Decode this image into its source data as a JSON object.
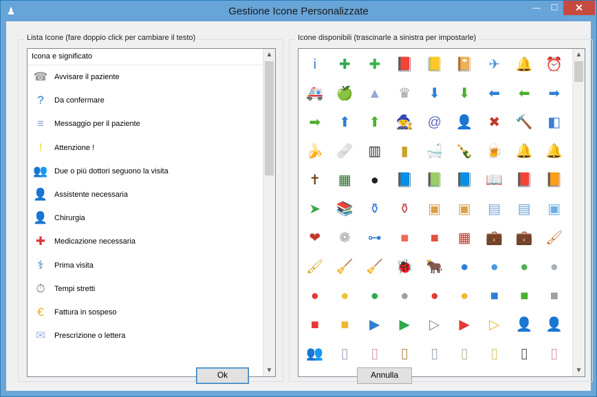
{
  "window": {
    "title": "Gestione Icone Personalizzate",
    "minimize": "—",
    "maximize": "☐",
    "close": "✕",
    "app_icon": "♟"
  },
  "left_panel": {
    "title": "Lista Icone (fare doppio click per cambiare il testo)",
    "header": "Icona e significato",
    "items": [
      {
        "label": "Avvisare il paziente",
        "icon": "phone-icon",
        "glyph": "☎",
        "color": "#9a9a9a"
      },
      {
        "label": "Da confermare",
        "icon": "question-icon",
        "glyph": "?",
        "color": "#2d79c9"
      },
      {
        "label": "Messaggio per il paziente",
        "icon": "message-icon",
        "glyph": "≡",
        "color": "#8ba2d8"
      },
      {
        "label": "Attenzione !",
        "icon": "warning-icon",
        "glyph": "!",
        "color": "#f2d63a"
      },
      {
        "label": "Due o più dottori seguono la visita",
        "icon": "doctors-icon",
        "glyph": "👥",
        "color": "#5b9bd5"
      },
      {
        "label": "Assistente necessaria",
        "icon": "assistant-icon",
        "glyph": "👤",
        "color": "#8bc34a"
      },
      {
        "label": "Chirurgia",
        "icon": "surgeon-icon",
        "glyph": "👤",
        "color": "#64b5f6"
      },
      {
        "label": "Medicazione necessaria",
        "icon": "medical-cross-icon",
        "glyph": "✚",
        "color": "#d9383a"
      },
      {
        "label": "Prima visita",
        "icon": "stethoscope-icon",
        "glyph": "⚕",
        "color": "#3d6fb6"
      },
      {
        "label": "Tempi stretti",
        "icon": "stopwatch-icon",
        "glyph": "⏱",
        "color": "#8a8a8a"
      },
      {
        "label": "Fattura in sospeso",
        "icon": "euro-coin-icon",
        "glyph": "€",
        "color": "#f0a820"
      },
      {
        "label": "Prescrizione o lettera",
        "icon": "envelope-icon",
        "glyph": "✉",
        "color": "#a7b8e0"
      }
    ]
  },
  "right_panel": {
    "title": "Icone disponibili (trascinarle a sinistra per impostarle)",
    "icons": [
      {
        "name": "info-icon",
        "glyph": "i",
        "color": "#3a78c9"
      },
      {
        "name": "plus-circle-icon",
        "glyph": "✚",
        "color": "#2fa84f"
      },
      {
        "name": "plus-icon",
        "glyph": "✚",
        "color": "#37b34a"
      },
      {
        "name": "book-icon",
        "glyph": "📕",
        "color": "#7a7a7a"
      },
      {
        "name": "address-book-icon",
        "glyph": "📒",
        "color": "#d8b23a"
      },
      {
        "name": "address-book-at-icon",
        "glyph": "📔",
        "color": "#d8a93a"
      },
      {
        "name": "airplane-icon",
        "glyph": "✈",
        "color": "#4a90d9"
      },
      {
        "name": "alarm-bell-icon",
        "glyph": "🔔",
        "color": "#d23b2e"
      },
      {
        "name": "alarm-clock-icon",
        "glyph": "⏰",
        "color": "#d23b2e"
      },
      {
        "name": "ambulance-icon",
        "glyph": "🚑",
        "color": "#d8d8d8"
      },
      {
        "name": "apple-icon",
        "glyph": "🍏",
        "color": "#4caf2f"
      },
      {
        "name": "shark-fin-icon",
        "glyph": "▲",
        "color": "#9aa6d8"
      },
      {
        "name": "chef-hat-icon",
        "glyph": "♛",
        "color": "#9e9e9e"
      },
      {
        "name": "arrow-down-blue-icon",
        "glyph": "⬇",
        "color": "#2f7fd6"
      },
      {
        "name": "arrow-down-green-icon",
        "glyph": "⬇",
        "color": "#4caf2f"
      },
      {
        "name": "arrow-left-blue-icon",
        "glyph": "⬅",
        "color": "#2f7fd6"
      },
      {
        "name": "arrow-left-green-icon",
        "glyph": "⬅",
        "color": "#4caf2f"
      },
      {
        "name": "arrow-right-blue-icon",
        "glyph": "➡",
        "color": "#2f7fd6"
      },
      {
        "name": "arrow-right-green-icon",
        "glyph": "➡",
        "color": "#4caf2f"
      },
      {
        "name": "arrow-up-blue-icon",
        "glyph": "⬆",
        "color": "#2f7fd6"
      },
      {
        "name": "arrow-up-green-icon",
        "glyph": "⬆",
        "color": "#4caf2f"
      },
      {
        "name": "wizard-icon",
        "glyph": "🧙",
        "color": "#7e57c2"
      },
      {
        "name": "at-sign-icon",
        "glyph": "@",
        "color": "#5c6bc0"
      },
      {
        "name": "user-bomb-icon",
        "glyph": "👤",
        "color": "#c77b3a"
      },
      {
        "name": "bug-icon",
        "glyph": "✖",
        "color": "#c0392b"
      },
      {
        "name": "gavel-icon",
        "glyph": "🔨",
        "color": "#c9a227"
      },
      {
        "name": "squares-icon",
        "glyph": "◧",
        "color": "#3d7fd6"
      },
      {
        "name": "bananas-icon",
        "glyph": "🍌",
        "color": "#f2c82f"
      },
      {
        "name": "bandage-icon",
        "glyph": "🩹",
        "color": "#f4a65a"
      },
      {
        "name": "barcode-icon",
        "glyph": "▥",
        "color": "#333333"
      },
      {
        "name": "battery-icon",
        "glyph": "▮",
        "color": "#c9a227"
      },
      {
        "name": "bathtub-icon",
        "glyph": "🛁",
        "color": "#7ea6d8"
      },
      {
        "name": "beer-bottle-icon",
        "glyph": "🍾",
        "color": "#2e8b3a"
      },
      {
        "name": "beer-glass-icon",
        "glyph": "🍺",
        "color": "#f2b630"
      },
      {
        "name": "bell-icon",
        "glyph": "🔔",
        "color": "#d8a520"
      },
      {
        "name": "bells-icon",
        "glyph": "🔔",
        "color": "#c99a2e"
      },
      {
        "name": "bible-icon",
        "glyph": "✝",
        "color": "#6b4a1e"
      },
      {
        "name": "blackboard-icon",
        "glyph": "▦",
        "color": "#2e6b2e"
      },
      {
        "name": "bomb-icon",
        "glyph": "●",
        "color": "#222222"
      },
      {
        "name": "book-blue-icon",
        "glyph": "📘",
        "color": "#2f6fc9"
      },
      {
        "name": "book-green-icon",
        "glyph": "📗",
        "color": "#2e9b4a"
      },
      {
        "name": "book-blue-open-icon",
        "glyph": "📘",
        "color": "#3a7fd6"
      },
      {
        "name": "book-open-icon",
        "glyph": "📖",
        "color": "#7a8fd0"
      },
      {
        "name": "book-red-icon",
        "glyph": "📕",
        "color": "#d23b2e"
      },
      {
        "name": "book-yellow-icon",
        "glyph": "📙",
        "color": "#e0a82e"
      },
      {
        "name": "bookmark-icon",
        "glyph": "➤",
        "color": "#3aa84f"
      },
      {
        "name": "books-stack-icon",
        "glyph": "📚",
        "color": "#3a8fd6"
      },
      {
        "name": "bottle-icon",
        "glyph": "⚱",
        "color": "#3a7fd6"
      },
      {
        "name": "pill-bottle-icon",
        "glyph": "⚱",
        "color": "#c94f4f"
      },
      {
        "name": "box-open-icon",
        "glyph": "▣",
        "color": "#d8a24a"
      },
      {
        "name": "box-closed-icon",
        "glyph": "▣",
        "color": "#d8a24a"
      },
      {
        "name": "documents-icon",
        "glyph": "▤",
        "color": "#7ea6d8"
      },
      {
        "name": "document-blue-icon",
        "glyph": "▤",
        "color": "#6c9fd6"
      },
      {
        "name": "box-blue-icon",
        "glyph": "▣",
        "color": "#6ab0e0"
      },
      {
        "name": "heart-broken-icon",
        "glyph": "❤",
        "color": "#c0392b"
      },
      {
        "name": "brain-icon",
        "glyph": "❁",
        "color": "#a0a0a0"
      },
      {
        "name": "network-icon",
        "glyph": "⊶",
        "color": "#2f7fd6"
      },
      {
        "name": "square-red-gradient-icon",
        "glyph": "■",
        "color": "#ef6a57"
      },
      {
        "name": "squares-red-icon",
        "glyph": "■",
        "color": "#e0523f"
      },
      {
        "name": "brick-wall-icon",
        "glyph": "▦",
        "color": "#c0392b"
      },
      {
        "name": "briefcase-grey-icon",
        "glyph": "💼",
        "color": "#555555"
      },
      {
        "name": "briefcase-brown-icon",
        "glyph": "💼",
        "color": "#9a6a2a"
      },
      {
        "name": "paint-brush-icon",
        "glyph": "🖌",
        "color": "#c77b3a"
      },
      {
        "name": "brush-bottle-icon",
        "glyph": "🖌",
        "color": "#d8a520"
      },
      {
        "name": "broom-blue-icon",
        "glyph": "🧹",
        "color": "#3a7fd6"
      },
      {
        "name": "broom-green-icon",
        "glyph": "🧹",
        "color": "#4caf2f"
      },
      {
        "name": "ladybug-icon",
        "glyph": "🐞",
        "color": "#d23b2e"
      },
      {
        "name": "bull-icon",
        "glyph": "🐂",
        "color": "#777777"
      },
      {
        "name": "dot-blue-icon",
        "glyph": "●",
        "color": "#2f7fd6"
      },
      {
        "name": "dot-blue-light-icon",
        "glyph": "●",
        "color": "#4a9be0"
      },
      {
        "name": "dot-green-icon",
        "glyph": "●",
        "color": "#4caf50"
      },
      {
        "name": "dot-grey-icon",
        "glyph": "●",
        "color": "#a8b2b8"
      },
      {
        "name": "dot-red-icon",
        "glyph": "●",
        "color": "#e53935"
      },
      {
        "name": "dot-yellow-icon",
        "glyph": "●",
        "color": "#f2c12e"
      },
      {
        "name": "dot-green-2-icon",
        "glyph": "●",
        "color": "#2fa84f"
      },
      {
        "name": "dot-silver-icon",
        "glyph": "●",
        "color": "#9e9e9e"
      },
      {
        "name": "dot-red-2-icon",
        "glyph": "●",
        "color": "#e53935"
      },
      {
        "name": "dot-amber-icon",
        "glyph": "●",
        "color": "#f2b630"
      },
      {
        "name": "square-blue-icon",
        "glyph": "■",
        "color": "#2f7fd6"
      },
      {
        "name": "square-green-icon",
        "glyph": "■",
        "color": "#4caf2f"
      },
      {
        "name": "square-grey-icon",
        "glyph": "■",
        "color": "#a0a0a0"
      },
      {
        "name": "square-red-icon",
        "glyph": "■",
        "color": "#e53935"
      },
      {
        "name": "square-yellow-icon",
        "glyph": "■",
        "color": "#f2b630"
      },
      {
        "name": "play-blue-icon",
        "glyph": "▶",
        "color": "#2f7fd6"
      },
      {
        "name": "play-green-icon",
        "glyph": "▶",
        "color": "#2fa84f"
      },
      {
        "name": "play-grey-icon",
        "glyph": "▷",
        "color": "#8a8a8a"
      },
      {
        "name": "play-red-icon",
        "glyph": "▶",
        "color": "#e53935"
      },
      {
        "name": "play-yellow-icon",
        "glyph": "▷",
        "color": "#f2b630"
      },
      {
        "name": "businessman-blue-icon",
        "glyph": "👤",
        "color": "#2f5fa8"
      },
      {
        "name": "businessman-grey-icon",
        "glyph": "👤",
        "color": "#555555"
      },
      {
        "name": "users-icon",
        "glyph": "👥",
        "color": "#c77b3a"
      },
      {
        "name": "cabinet-icon",
        "glyph": "▯",
        "color": "#a0a8b8"
      },
      {
        "name": "cabinet-pink-icon",
        "glyph": "▯",
        "color": "#d89aa8"
      },
      {
        "name": "cabinet-open-icon",
        "glyph": "▯",
        "color": "#b08a4a"
      },
      {
        "name": "cabinet-2-icon",
        "glyph": "▯",
        "color": "#a0a8b8"
      },
      {
        "name": "cabinet-lock-icon",
        "glyph": "▯",
        "color": "#b8b8a0"
      },
      {
        "name": "cabinet-yellow-icon",
        "glyph": "▯",
        "color": "#d8c878"
      },
      {
        "name": "cabinet-dark-icon",
        "glyph": "▯",
        "color": "#555555"
      },
      {
        "name": "cabinet-pink-2-icon",
        "glyph": "▯",
        "color": "#d89aa8"
      }
    ]
  },
  "buttons": {
    "ok": "Ok",
    "cancel": "Annulla"
  },
  "scroll": {
    "up": "▲",
    "down": "▼"
  }
}
